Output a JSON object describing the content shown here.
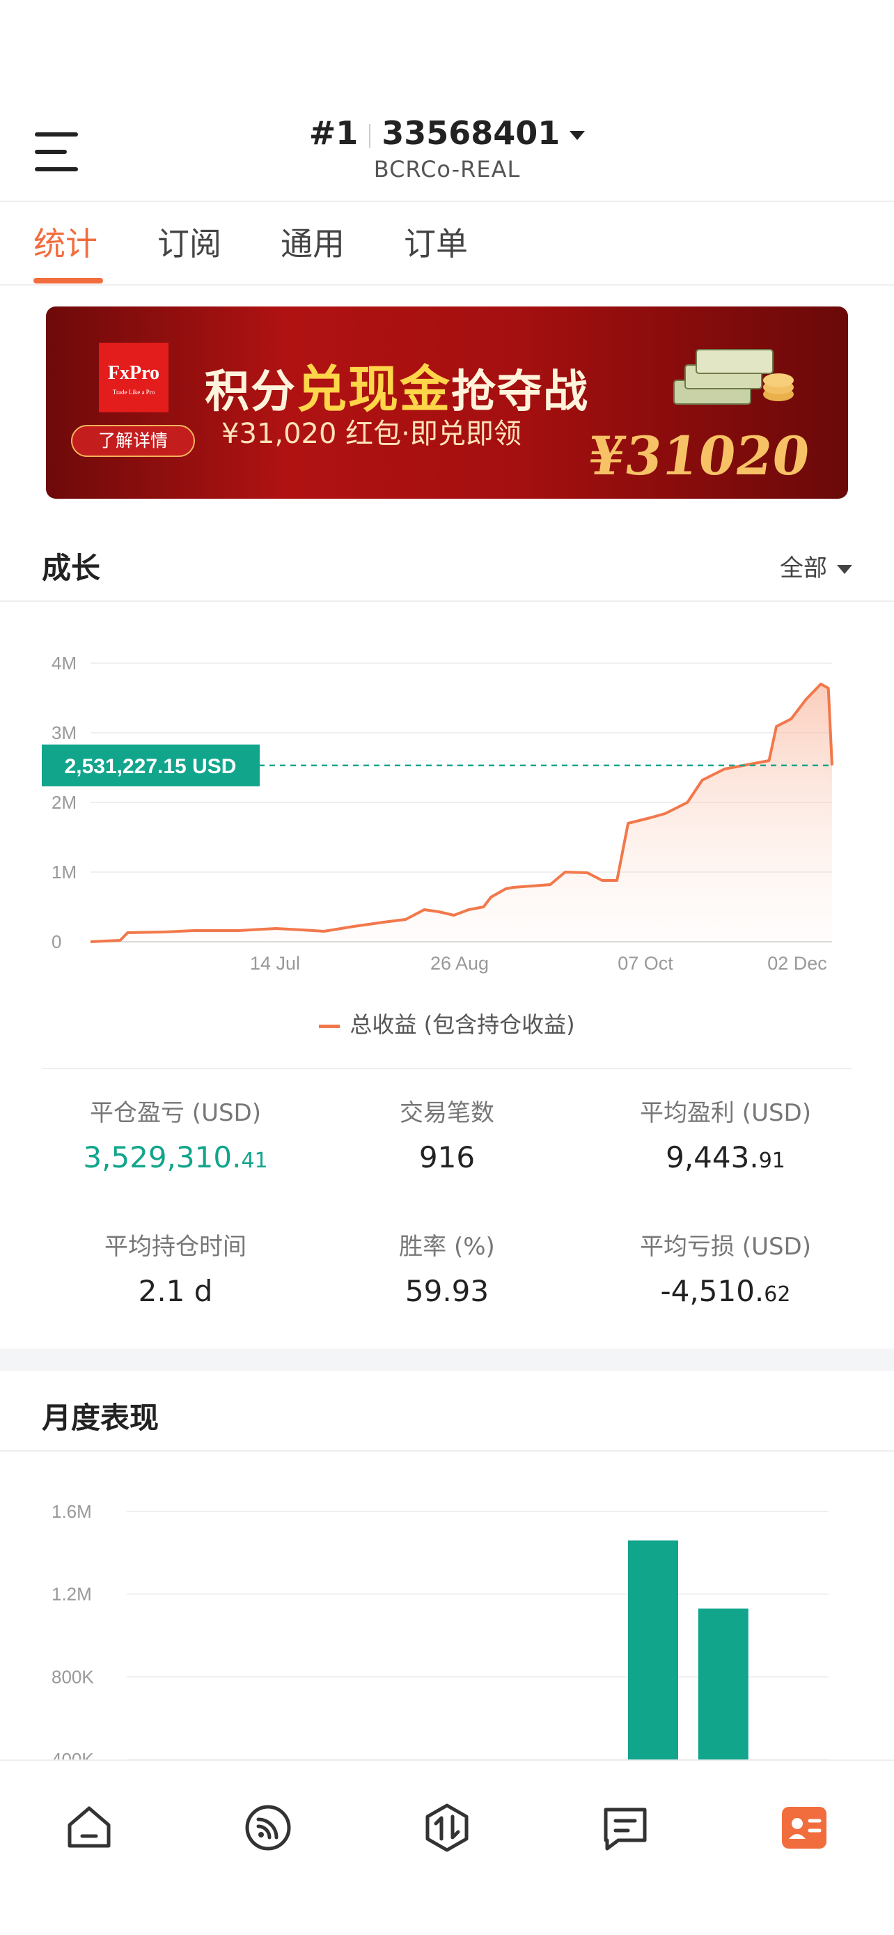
{
  "header": {
    "account_index": "#1",
    "account_number": "33568401",
    "server": "BCRCo-REAL"
  },
  "tabs": [
    {
      "label": "统计",
      "active": true
    },
    {
      "label": "订阅",
      "active": false
    },
    {
      "label": "通用",
      "active": false
    },
    {
      "label": "订单",
      "active": false
    }
  ],
  "banner": {
    "logo_brand": "FxPro",
    "logo_tagline": "Trade Like a Pro",
    "button_label": "了解详情",
    "headline_a": "积分",
    "headline_b": "兑现金",
    "headline_c": "抢夺战",
    "subline": "¥31,020 红包·即兑即领",
    "amount": "¥31020"
  },
  "growth": {
    "title": "成长",
    "filter_label": "全部",
    "legend_label": "总收益 (包含持仓收益)",
    "current_value_label": "2,531,227.15 USD",
    "colors": {
      "line": "#f2784b",
      "marker": "#11a58c"
    }
  },
  "chart_data": [
    {
      "type": "area",
      "y_ticks": [
        "0",
        "1M",
        "2M",
        "3M",
        "4M"
      ],
      "x_ticks": [
        "14 Jul",
        "26 Aug",
        "07 Oct",
        "02 Dec"
      ],
      "ylim": [
        0,
        4000000
      ],
      "current_value": 2531227.15,
      "grid": true,
      "legend": "bottom",
      "series": [
        {
          "name": "总收益 (包含持仓收益)",
          "points": [
            [
              "Jun 10",
              0
            ],
            [
              "Jun 18",
              20000
            ],
            [
              "Jun 20",
              130000
            ],
            [
              "Jun 30",
              140000
            ],
            [
              "Jul 08",
              160000
            ],
            [
              "Jul 20",
              160000
            ],
            [
              "Jul 30",
              190000
            ],
            [
              "Aug 06",
              170000
            ],
            [
              "Aug 12",
              150000
            ],
            [
              "Aug 20",
              220000
            ],
            [
              "Aug 28",
              280000
            ],
            [
              "Sep 03",
              320000
            ],
            [
              "Sep 08",
              460000
            ],
            [
              "Sep 12",
              430000
            ],
            [
              "Sep 16",
              380000
            ],
            [
              "Sep 20",
              460000
            ],
            [
              "Sep 24",
              500000
            ],
            [
              "Sep 26",
              640000
            ],
            [
              "Sep 30",
              760000
            ],
            [
              "Oct 02",
              780000
            ],
            [
              "Oct 07",
              800000
            ],
            [
              "Oct 12",
              820000
            ],
            [
              "Oct 16",
              1000000
            ],
            [
              "Oct 22",
              990000
            ],
            [
              "Oct 26",
              880000
            ],
            [
              "Oct 30",
              880000
            ],
            [
              "Nov 02",
              1700000
            ],
            [
              "Nov 08",
              1780000
            ],
            [
              "Nov 12",
              1840000
            ],
            [
              "Nov 18",
              2000000
            ],
            [
              "Nov 22",
              2320000
            ],
            [
              "Nov 28",
              2480000
            ],
            [
              "Dec 02",
              2520000
            ],
            [
              "Dec 06",
              2560000
            ],
            [
              "Dec 10",
              2600000
            ],
            [
              "Dec 12",
              3090000
            ],
            [
              "Dec 16",
              3200000
            ],
            [
              "Dec 20",
              3480000
            ],
            [
              "Dec 24",
              3700000
            ],
            [
              "Dec 26",
              3640000
            ],
            [
              "Dec 27",
              2531227.15
            ]
          ]
        }
      ]
    },
    {
      "type": "bar",
      "y_ticks": [
        "400K",
        "800K",
        "1.2M",
        "1.6M"
      ],
      "ylim": [
        400000,
        1600000
      ],
      "grid": true,
      "bars": [
        {
          "slot": 8,
          "value": 1460000
        },
        {
          "slot": 9,
          "value": 1130000
        }
      ],
      "slots": 10,
      "bar_color": "#11a58c"
    }
  ],
  "stats": [
    {
      "label": "平仓盈亏 (USD)",
      "int": "3,529,310.",
      "dec": "41",
      "green": true
    },
    {
      "label": "交易笔数",
      "int": "916",
      "dec": "",
      "green": false
    },
    {
      "label": "平均盈利 (USD)",
      "int": "9,443.",
      "dec": "91",
      "green": false
    },
    {
      "label": "平均持仓时间",
      "int": "2.1 d",
      "dec": "",
      "green": false
    },
    {
      "label": "胜率 (%)",
      "int": "59.93",
      "dec": "",
      "green": false
    },
    {
      "label": "平均亏损 (USD)",
      "int": "-4,510.",
      "dec": "62",
      "green": false
    }
  ],
  "monthly": {
    "title": "月度表现"
  },
  "bottom_nav": [
    {
      "icon": "home-icon"
    },
    {
      "icon": "signal-feed-icon"
    },
    {
      "icon": "trade-icon"
    },
    {
      "icon": "message-icon"
    },
    {
      "icon": "account-card-icon",
      "active": true
    }
  ]
}
